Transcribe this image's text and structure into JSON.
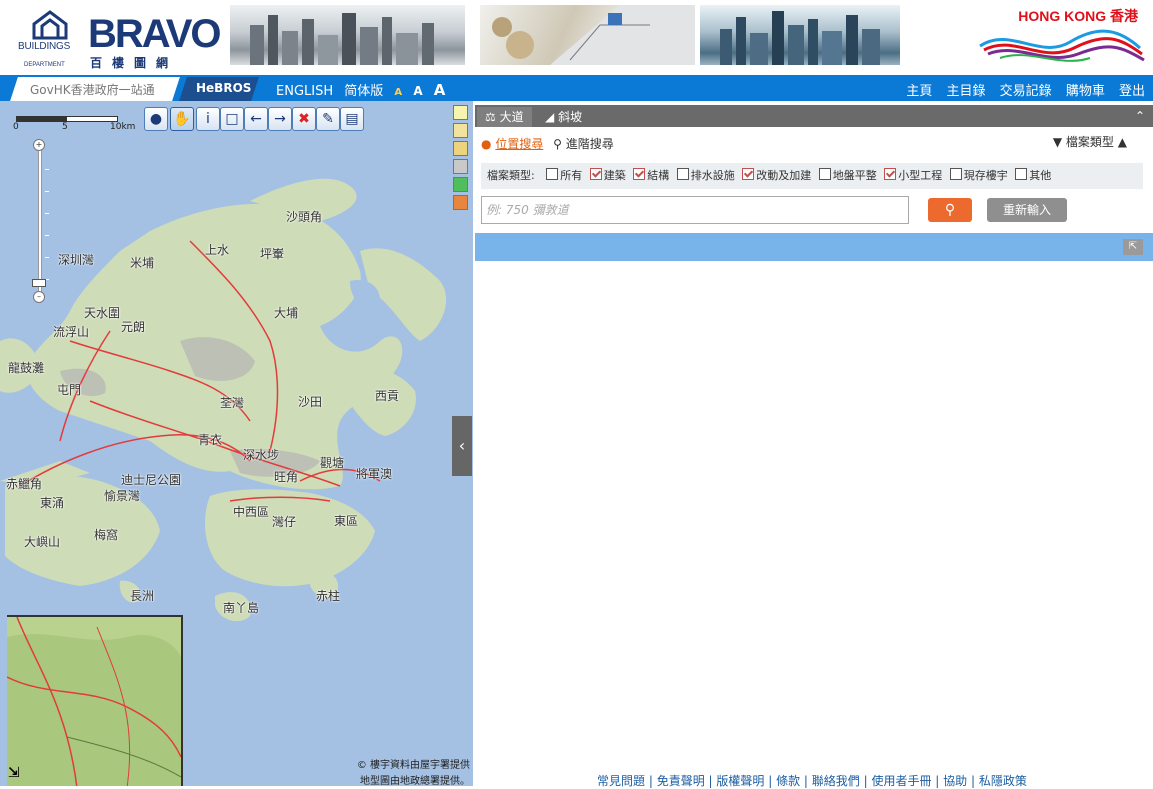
{
  "banner": {
    "dept_en_line1": "BUILDINGS",
    "dept_en_line2": "DEPARTMENT",
    "app_name": "BRAVO",
    "app_sub": "百樓圖網",
    "brand": "HONG KONG 香港"
  },
  "navbar": {
    "govhk": "GovHK香港政府一站通",
    "hebros": "HeBROS",
    "english": "ENGLISH",
    "simplified": "简体版",
    "font_sizes": [
      "A",
      "A",
      "A"
    ],
    "right_links": [
      "主頁",
      "主目錄",
      "交易記錄",
      "購物車",
      "登出"
    ]
  },
  "map": {
    "scale_labels": [
      "0",
      "5",
      "10km"
    ],
    "tool_icons": [
      "globe-icon",
      "hand-icon",
      "info-icon",
      "select-box-icon",
      "back-arrow-icon",
      "forward-arrow-icon",
      "clear-icon",
      "eraser-icon",
      "book-icon"
    ],
    "layer_colors": [
      "#f6f5b0",
      "#f1e39d",
      "#eed37e",
      "#c9c9c9",
      "#4fbf5b",
      "#e8853f"
    ],
    "place_labels": [
      "沙頭角",
      "上水",
      "深圳灣",
      "米埔",
      "坪輋",
      "天水圍",
      "元朗",
      "流浮山",
      "大埔",
      "龍鼓灘",
      "屯門",
      "荃灣",
      "沙田",
      "西貢",
      "青衣",
      "深水埗",
      "觀塘",
      "將軍澳",
      "赤鱲角",
      "迪士尼公園",
      "東涌",
      "愉景灣",
      "旺角",
      "中西區",
      "灣仔",
      "東區",
      "大嶼山",
      "梅窩",
      "長洲",
      "南丫島",
      "赤柱"
    ],
    "credit_line1": "© 樓宇資料由屋宇署提供",
    "credit_line2": "地型圖由地政總署提供。"
  },
  "panel": {
    "tab_street": "大道",
    "tab_slope": "斜坡",
    "location_search": "位置搜尋",
    "advanced_search": "進階搜尋",
    "file_type_toggle": "檔案類型",
    "types_label": "檔案類型:",
    "types": [
      {
        "label": "所有",
        "checked": false
      },
      {
        "label": "建築",
        "checked": true
      },
      {
        "label": "結構",
        "checked": true
      },
      {
        "label": "排水設施",
        "checked": false
      },
      {
        "label": "改動及加建",
        "checked": true
      },
      {
        "label": "地盤平整",
        "checked": false
      },
      {
        "label": "小型工程",
        "checked": true
      },
      {
        "label": "現存樓宇",
        "checked": false
      },
      {
        "label": "其他",
        "checked": false
      }
    ],
    "search_placeholder": "例: 750 彌敦道",
    "reset_button": "重新輸入"
  },
  "footer": {
    "links": [
      "常見問題",
      "免責聲明",
      "版權聲明",
      "條款",
      "聯絡我們",
      "使用者手冊",
      "協助",
      "私隱政策"
    ]
  },
  "colors": {
    "nav_blue": "#0b79d6",
    "result_bar": "#78b4ea",
    "search_orange": "#ec6a2e",
    "tab_grey": "#6a6a6a"
  }
}
